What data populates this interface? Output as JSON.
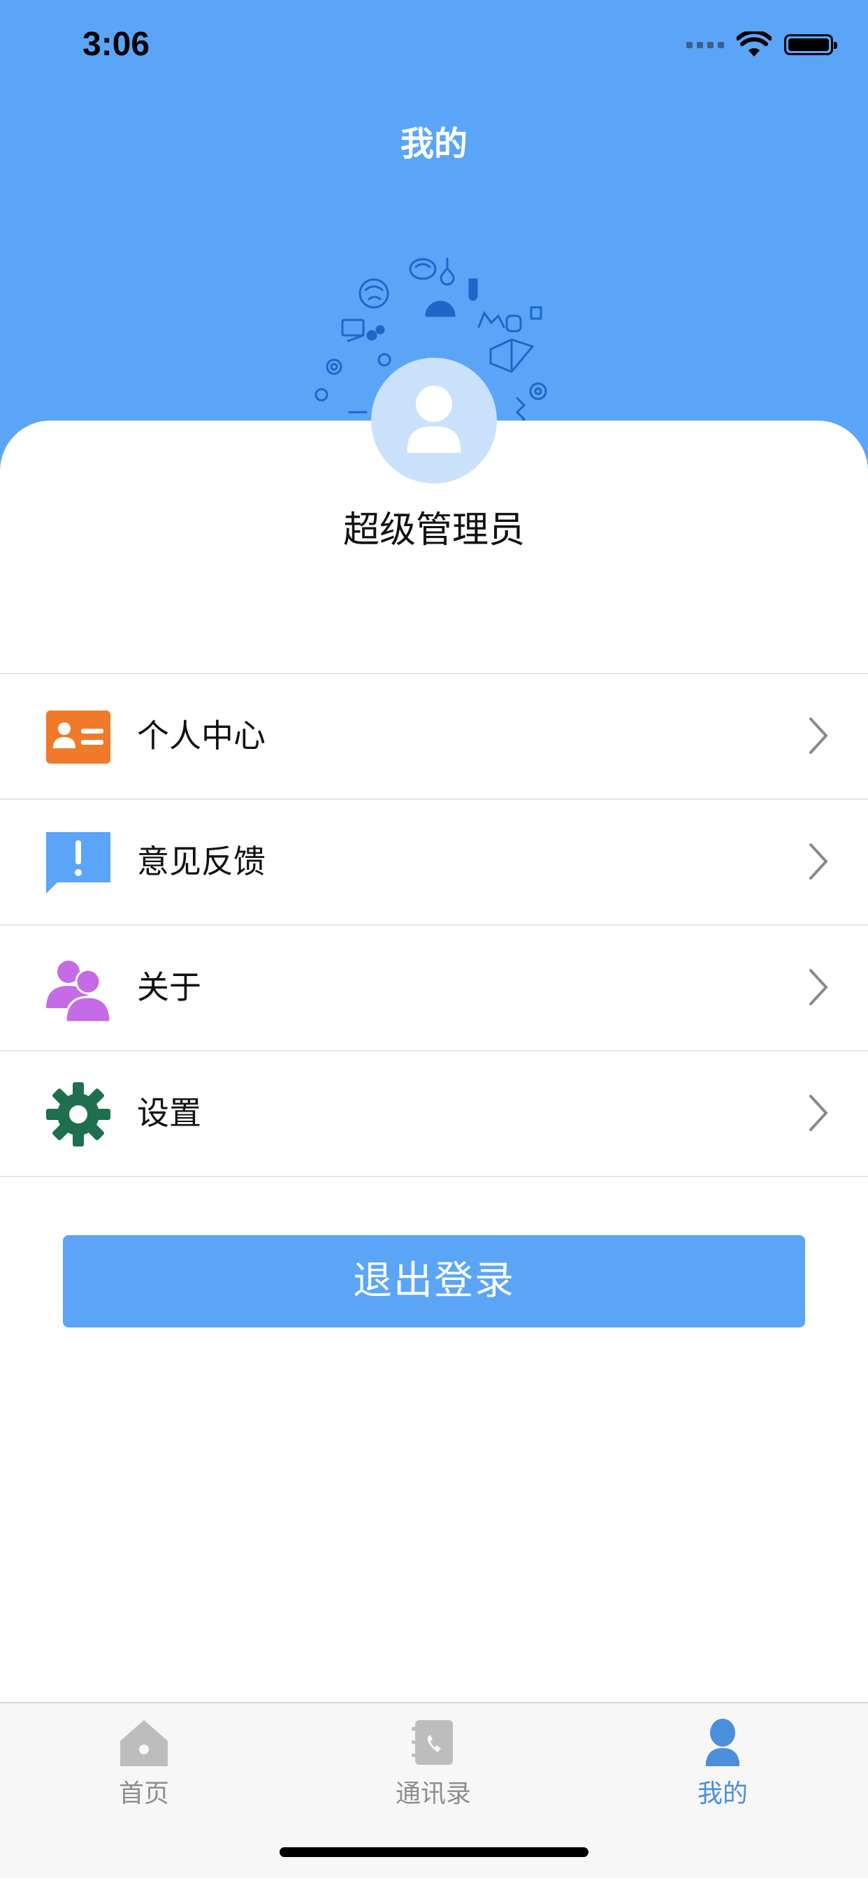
{
  "status_bar": {
    "time": "3:06"
  },
  "header": {
    "title": "我的"
  },
  "profile": {
    "name": "超级管理员"
  },
  "menu": [
    {
      "label": "个人中心",
      "icon": "id-card-icon",
      "color": "#f07a2a"
    },
    {
      "label": "意见反馈",
      "icon": "feedback-icon",
      "color": "#5aa5f8"
    },
    {
      "label": "关于",
      "icon": "users-icon",
      "color": "#c56be6"
    },
    {
      "label": "设置",
      "icon": "gear-icon",
      "color": "#1f6e4e"
    }
  ],
  "logout": {
    "label": "退出登录"
  },
  "tabbar": {
    "items": [
      {
        "label": "首页",
        "icon": "home-icon",
        "active": false
      },
      {
        "label": "通讯录",
        "icon": "contacts-icon",
        "active": false
      },
      {
        "label": "我的",
        "icon": "profile-icon",
        "active": true
      }
    ]
  },
  "colors": {
    "primary": "#5aa5f8",
    "active_tab": "#4a8fdb",
    "inactive_tab": "#8e8e8e"
  }
}
